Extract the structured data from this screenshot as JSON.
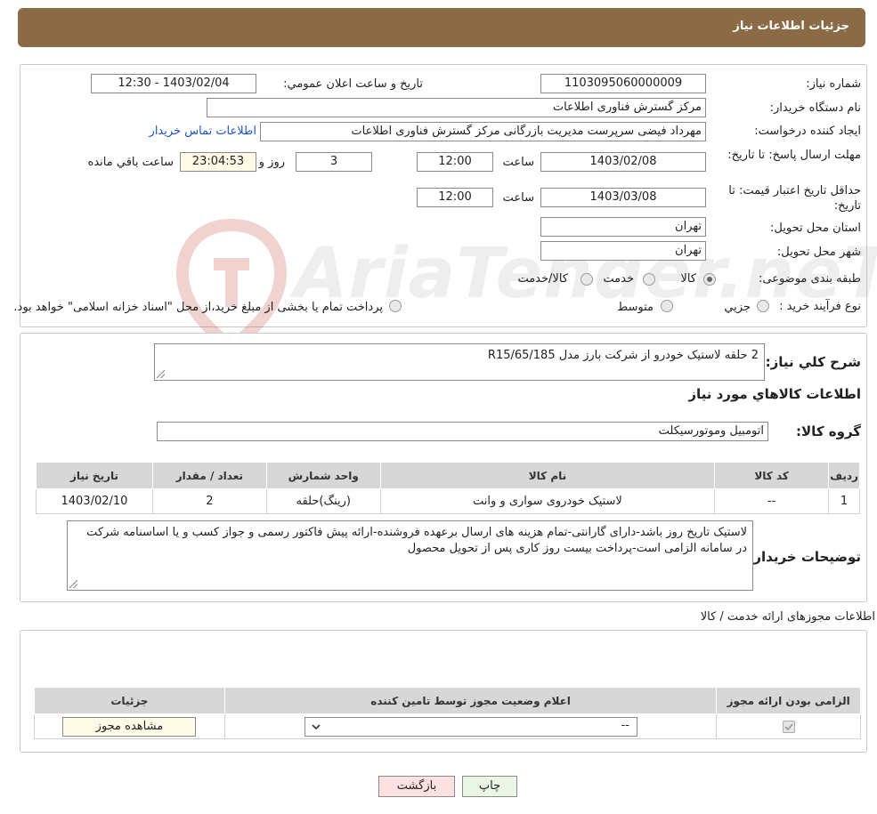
{
  "header": {
    "title": "جزئیات اطلاعات نیاز"
  },
  "form": {
    "need_number_label": "شماره نیاز:",
    "need_number": "1103095060000009",
    "announce_label": "تاریخ و ساعت اعلان عمومي:",
    "announce_value": "1403/02/04 - 12:30",
    "buyer_org_label": "نام دستگاه خريدار:",
    "buyer_org": "مرکز گسترش فناوری اطلاعات",
    "creator_label": "ايجاد کننده درخواست:",
    "creator": "مهرداد فیضی سرپرست مدیریت بازرگانی مرکز گسترش فناوری اطلاعات",
    "contact_link": "اطلاعات تماس خريدار",
    "deadline_label": "مهلت ارسال پاسخ: تا تاريخ:",
    "deadline_date": "1403/02/08",
    "time_label": "ساعت",
    "deadline_time": "12:00",
    "days_value": "3",
    "days_label": "روز و",
    "remaining_time": "23:04:53",
    "remaining_label": "ساعت باقي مانده",
    "validity_label": "حداقل تاريخ اعتبار قيمت: تا تاريخ:",
    "validity_date": "1403/03/08",
    "validity_time": "12:00",
    "province_label": "استان محل تحويل:",
    "province": "تهران",
    "city_label": "شهر محل تحويل:",
    "city": "تهران",
    "category_label": "طبقه بندی موضوعی:",
    "category_options": [
      "کالا",
      "خدمت",
      "کالا/خدمت"
    ],
    "category_selected": "کالا",
    "process_label": "نوع فرآيند خريد :",
    "process_options": [
      "جزيي",
      "متوسط"
    ],
    "process_note": "پرداخت تمام يا بخشی از مبلغ خريد،از محل \"اسناد خزانه اسلامی\" خواهد بود."
  },
  "description": {
    "label": "شرح كلي نياز:",
    "text": "2 حلقه لاستیک خودرو از شرکت بارز مدل R15/65/185"
  },
  "goods": {
    "title": "اطلاعات كالاهاي مورد نياز",
    "group_label": "گروه کالا:",
    "group_value": "اتومبيل وموتورسيكلت",
    "table_headers": [
      "رديف",
      "کد کالا",
      "نام کالا",
      "واحد شمارش",
      "تعداد / مقدار",
      "تاريخ نياز"
    ],
    "rows": [
      [
        "1",
        "--",
        "لاستیک خودروی سواری و وانت",
        "(رينگ)حلقه",
        "2",
        "1403/02/10"
      ]
    ]
  },
  "buyer_notes": {
    "label": "توضيحات خريدار:",
    "text": "لاستیک تاریخ روز باشد-دارای گارانتی-تمام هزینه های ارسال برعهده فروشنده-ارائه پیش فاکتور رسمی و جواز کسب و یا اساسنامه شرکت در سامانه الزامی است-پرداخت بیست روز کاری پس از تحویل محصول"
  },
  "licenses": {
    "title": "اطلاعات مجوزهای ارائه خدمت / کالا",
    "table_headers": [
      "الزامی بودن ارائه مجوز",
      "اعلام وضعیت مجوز توسط تامین کننده",
      "جزئیات"
    ],
    "select_value": "--",
    "view_button": "مشاهده مجوز"
  },
  "buttons": {
    "print": "چاپ",
    "back": "بازگشت"
  },
  "watermark": {
    "text": "AriaTender.neT"
  },
  "colors": {
    "header_bg": "#8B6A46",
    "link": "#1a55c8",
    "back_button_bg": "#fde1e1",
    "print_button_bg": "#eaf7e6"
  }
}
